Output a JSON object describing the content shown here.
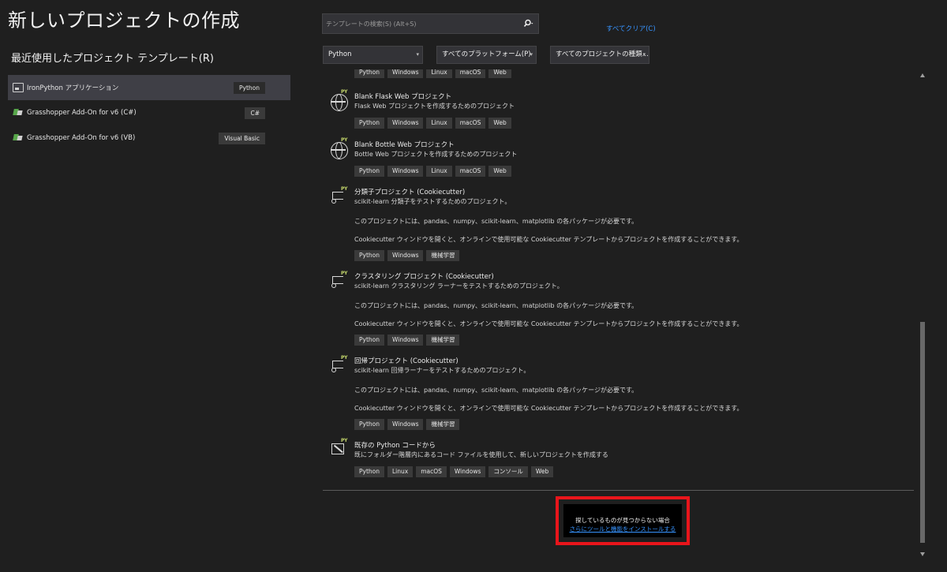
{
  "header": {
    "title": "新しいプロジェクトの作成",
    "recent_heading": "最近使用したプロジェクト テンプレート(R)"
  },
  "recent": [
    {
      "label": "IronPython アプリケーション",
      "tag": "Python",
      "icon": "monitor-icon",
      "selected": true
    },
    {
      "label": "Grasshopper Add-On for v6 (C#)",
      "tag": "C#",
      "icon": "grasshopper-icon",
      "selected": false
    },
    {
      "label": "Grasshopper Add-On for v6 (VB)",
      "tag": "Visual Basic",
      "icon": "grasshopper-icon",
      "selected": false
    }
  ],
  "search": {
    "placeholder": "テンプレートの検索(S) (Alt+S)",
    "value": ""
  },
  "clear_all": "すべてクリア(C)",
  "filters": {
    "language": "Python",
    "platform": "すべてのプラットフォーム(P)",
    "project_type": "すべてのプロジェクトの種類..."
  },
  "partial_tags": [
    "Python",
    "Windows",
    "Linux",
    "macOS",
    "Web"
  ],
  "templates": [
    {
      "name": "Blank Flask Web プロジェクト",
      "desc": "Flask Web プロジェクトを作成するためのプロジェクト",
      "icon": "globe-python-icon",
      "notes": [],
      "tags": [
        "Python",
        "Windows",
        "Linux",
        "macOS",
        "Web"
      ]
    },
    {
      "name": "Blank Bottle Web プロジェクト",
      "desc": "Bottle Web プロジェクトを作成するためのプロジェクト",
      "icon": "globe-python-icon",
      "notes": [],
      "tags": [
        "Python",
        "Windows",
        "Linux",
        "macOS",
        "Web"
      ]
    },
    {
      "name": "分類子プロジェクト (Cookiecutter)",
      "desc": "scikit-learn 分類子をテストするためのプロジェクト。",
      "icon": "cookiecutter-python-icon",
      "notes": [
        "このプロジェクトには、pandas、numpy、scikit-learn、matplotlib の各パッケージが必要です。",
        "Cookiecutter ウィンドウを開くと、オンラインで使用可能な Cookiecutter テンプレートからプロジェクトを作成することができます。"
      ],
      "tags": [
        "Python",
        "Windows",
        "機械学習"
      ]
    },
    {
      "name": "クラスタリング プロジェクト (Cookiecutter)",
      "desc": "scikit-learn クラスタリング ラーナーをテストするためのプロジェクト。",
      "icon": "cookiecutter-python-icon",
      "notes": [
        "このプロジェクトには、pandas、numpy、scikit-learn、matplotlib の各パッケージが必要です。",
        "Cookiecutter ウィンドウを開くと、オンラインで使用可能な Cookiecutter テンプレートからプロジェクトを作成することができます。"
      ],
      "tags": [
        "Python",
        "Windows",
        "機械学習"
      ]
    },
    {
      "name": "回帰プロジェクト (Cookiecutter)",
      "desc": "scikit-learn 回帰ラーナーをテストするためのプロジェクト。",
      "icon": "cookiecutter-python-icon",
      "notes": [
        "このプロジェクトには、pandas、numpy、scikit-learn、matplotlib の各パッケージが必要です。",
        "Cookiecutter ウィンドウを開くと、オンラインで使用可能な Cookiecutter テンプレートからプロジェクトを作成することができます。"
      ],
      "tags": [
        "Python",
        "Windows",
        "機械学習"
      ]
    },
    {
      "name": "既存の Python コードから",
      "desc": "既にフォルダー階層内にあるコード ファイルを使用して、新しいプロジェクトを作成する",
      "icon": "existing-code-python-icon",
      "notes": [],
      "tags": [
        "Python",
        "Linux",
        "macOS",
        "Windows",
        "コンソール",
        "Web"
      ]
    }
  ],
  "not_found": {
    "text": "探しているものが見つからない場合",
    "link": "さらにツールと機能をインストールする"
  },
  "colors": {
    "background": "#1f1f1f",
    "selected": "#3f3f46",
    "tag_bg": "#3a3a3a",
    "link": "#3794ff",
    "highlight_border": "#e8151b",
    "python_badge": "#c4d76b"
  }
}
